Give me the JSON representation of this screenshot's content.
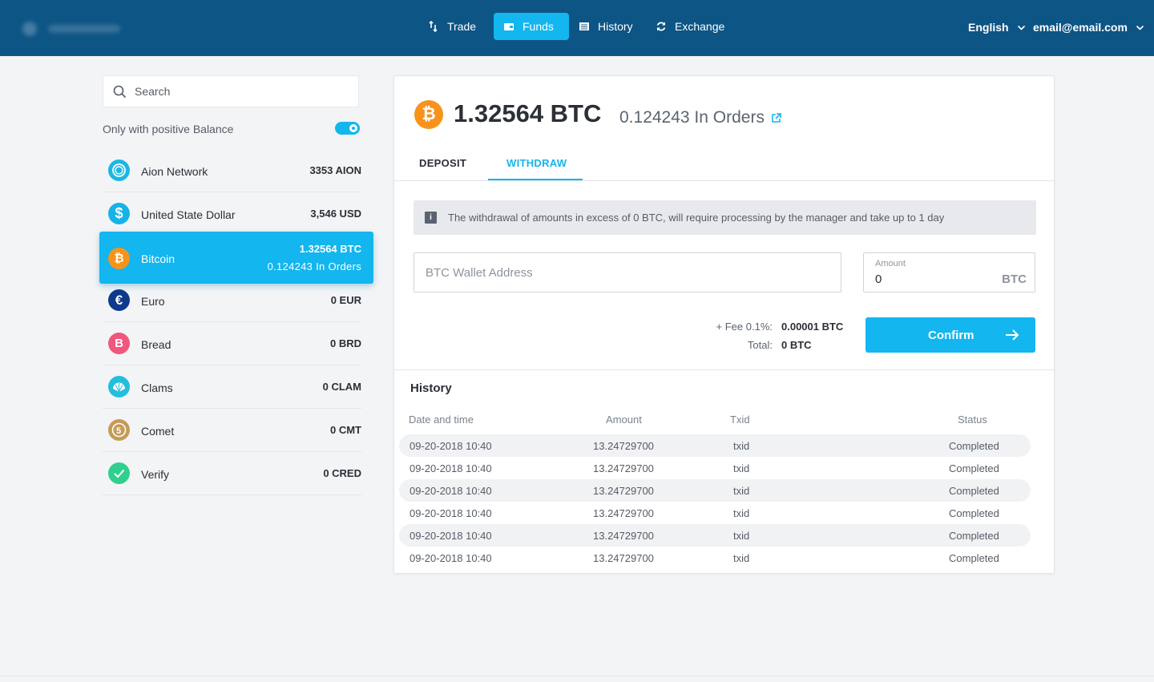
{
  "nav": {
    "trade": "Trade",
    "funds": "Funds",
    "history": "History",
    "exchange": "Exchange",
    "language": "English",
    "email": "email@email.com"
  },
  "sidebar": {
    "search_placeholder": "Search",
    "filter_label": "Only with positive Balance",
    "filter_on": true,
    "coins": [
      {
        "name": "Aion Network",
        "balance": "3353 AION",
        "icon": "aion-icon",
        "color": "#1ab7e4"
      },
      {
        "name": "United State Dollar",
        "balance": "3,546 USD",
        "icon": "dollar-icon",
        "color": "#16b3e8"
      },
      {
        "name": "Bitcoin",
        "balance": "1.32564 BTC",
        "in_orders": "0.124243 In Orders",
        "icon": "bitcoin-icon",
        "color": "#f7931a",
        "active": true
      },
      {
        "name": "Euro",
        "balance": "0 EUR",
        "icon": "euro-icon",
        "color": "#0d3a8c"
      },
      {
        "name": "Bread",
        "balance": "0 BRD",
        "icon": "bread-icon",
        "color": "#f0577a"
      },
      {
        "name": "Clams",
        "balance": "0 CLAM",
        "icon": "clams-icon",
        "color": "#23bede"
      },
      {
        "name": "Comet",
        "balance": "0 CMT",
        "icon": "comet-icon",
        "color": "#c69b57"
      },
      {
        "name": "Verify",
        "balance": "0 CRED",
        "icon": "verify-icon",
        "color": "#2fd08e"
      }
    ]
  },
  "main": {
    "balance": "1.32564 BTC",
    "in_orders": "0.124243 In Orders",
    "tabs": [
      "DEPOSIT",
      "WITHDRAW"
    ],
    "active_tab": "WITHDRAW",
    "notice": "The withdrawal of amounts in excess of 0 BTC, will require processing by the manager and take up to 1 day",
    "wallet_placeholder": "BTC Wallet Address",
    "amount_label": "Amount",
    "amount_value": "0",
    "amount_currency": "BTC",
    "fee_label": "+ Fee 0.1%:",
    "fee_value": "0.00001 BTC",
    "total_label": "Total:",
    "total_value": "0 BTC",
    "confirm_label": "Confirm"
  },
  "history": {
    "title": "History",
    "columns": [
      "Date and time",
      "Amount",
      "Txid",
      "Status"
    ],
    "rows": [
      {
        "date": "09-20-2018 10:40",
        "amount": "13.24729700",
        "txid": "txid",
        "status": "Completed"
      },
      {
        "date": "09-20-2018 10:40",
        "amount": "13.24729700",
        "txid": "txid",
        "status": "Completed"
      },
      {
        "date": "09-20-2018 10:40",
        "amount": "13.24729700",
        "txid": "txid",
        "status": "Completed"
      },
      {
        "date": "09-20-2018 10:40",
        "amount": "13.24729700",
        "txid": "txid",
        "status": "Completed"
      },
      {
        "date": "09-20-2018 10:40",
        "amount": "13.24729700",
        "txid": "txid",
        "status": "Completed"
      },
      {
        "date": "09-20-2018 10:40",
        "amount": "13.24729700",
        "txid": "txid",
        "status": "Completed"
      }
    ]
  },
  "colors": {
    "header": "#0d5585",
    "accent": "#13b6ee",
    "background": "#f3f4f6"
  }
}
